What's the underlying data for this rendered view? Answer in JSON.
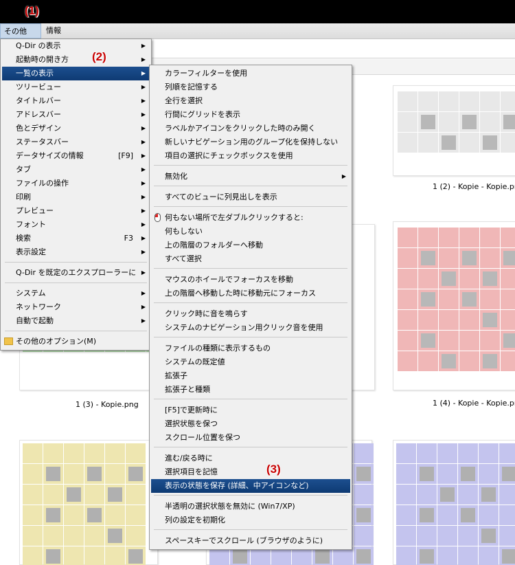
{
  "menubar": {
    "items": [
      {
        "label": "その他(X)"
      },
      {
        "label": "情報"
      }
    ]
  },
  "annotations": [
    "(1)",
    "(2)",
    "(3)"
  ],
  "main_menu": {
    "items": [
      {
        "label": "Q-Dir の表示",
        "arrow": "▶"
      },
      {
        "label": "起動時の開き方",
        "arrow": "▶"
      },
      {
        "label": "一覧の表示",
        "arrow": "▶"
      },
      {
        "label": "ツリービュー",
        "arrow": "▶"
      },
      {
        "label": "タイトルバー",
        "arrow": "▶"
      },
      {
        "label": "アドレスバー",
        "arrow": "▶"
      },
      {
        "label": "色とデザイン",
        "arrow": "▶"
      },
      {
        "label": "ステータスバー",
        "arrow": "▶"
      },
      {
        "label": "データサイズの情報",
        "shortcut": "[F9]",
        "arrow": "▶"
      },
      {
        "label": "タブ",
        "arrow": "▶"
      },
      {
        "label": "ファイルの操作",
        "arrow": "▶"
      },
      {
        "label": "印刷",
        "arrow": "▶"
      },
      {
        "label": "プレビュー",
        "arrow": "▶"
      },
      {
        "label": "フォント",
        "arrow": "▶"
      },
      {
        "label": "検索",
        "shortcut": "F3",
        "arrow": "▶"
      },
      {
        "label": "表示設定",
        "arrow": "▶"
      },
      {
        "label": "Q-Dir を既定のエクスプローラーに",
        "arrow": "▶"
      },
      {
        "label": "システム",
        "arrow": "▶"
      },
      {
        "label": "ネットワーク",
        "arrow": "▶"
      },
      {
        "label": "自動で起動",
        "arrow": "▶"
      },
      {
        "label": "その他のオプション(M)",
        "icon": "folder-icon"
      }
    ]
  },
  "sub_menu": {
    "items": [
      {
        "label": "カラーフィルターを使用"
      },
      {
        "label": "列順を記憶する"
      },
      {
        "label": "全行を選択"
      },
      {
        "label": "行間にグリッドを表示"
      },
      {
        "label": "ラベルかアイコンをクリックした時のみ開く"
      },
      {
        "label": "新しいナビゲーション用のグループ化を保持しない"
      },
      {
        "label": "項目の選択にチェックボックスを使用"
      },
      {
        "label": "無効化",
        "arrow": "▶"
      },
      {
        "label": "すべてのビューに列見出しを表示"
      },
      {
        "label": "何もない場所で左ダブルクリックすると:",
        "icon": "mouse-icon"
      },
      {
        "label": "何もしない"
      },
      {
        "label": "上の階層のフォルダーへ移動"
      },
      {
        "label": "すべて選択"
      },
      {
        "label": "マウスのホイールでフォーカスを移動"
      },
      {
        "label": "上の階層へ移動した時に移動元にフォーカス"
      },
      {
        "label": "クリック時に音を鳴らす"
      },
      {
        "label": "システムのナビゲーション用クリック音を使用"
      },
      {
        "label": "ファイルの種類に表示するもの"
      },
      {
        "label": "システムの既定値"
      },
      {
        "label": "拡張子"
      },
      {
        "label": "拡張子と種類"
      },
      {
        "label": "[F5]で更新時に"
      },
      {
        "label": "選択状態を保つ"
      },
      {
        "label": "スクロール位置を保つ"
      },
      {
        "label": "進む/戻る時に"
      },
      {
        "label": "選択項目を記憶"
      },
      {
        "label": "表示の状態を保存 (詳細、中アイコンなど)"
      },
      {
        "label": "半透明の選択状態を無効に (Win7/XP)"
      },
      {
        "label": "列の設定を初期化"
      },
      {
        "label": "スペースキーでスクロール (ブラウザのように)"
      }
    ]
  },
  "thumbnails": [
    {
      "label": "1 (2) - Kopie - Kopie.pn",
      "color": "#e8e8e8",
      "shade": "#b8b8b8"
    },
    {
      "label": "1 (3) - Kopie.png",
      "color": "#b9e6b2",
      "shade": "#b8b8b8"
    },
    {
      "label": "1 (4) - Kopie - Kopie.pn",
      "color": "#f0b7b7",
      "shade": "#b8b8b8"
    },
    {
      "label": "",
      "color": "#eee6b0",
      "shade": "#b0b0b0"
    },
    {
      "label": "",
      "color": "#c4c4ee",
      "shade": "#b0b0b0"
    },
    {
      "label": "",
      "color": "#c4c4ee",
      "shade": "#b0b0b0"
    }
  ],
  "colors": {
    "selection": "#0e3a73",
    "annotation": "#c80000"
  }
}
